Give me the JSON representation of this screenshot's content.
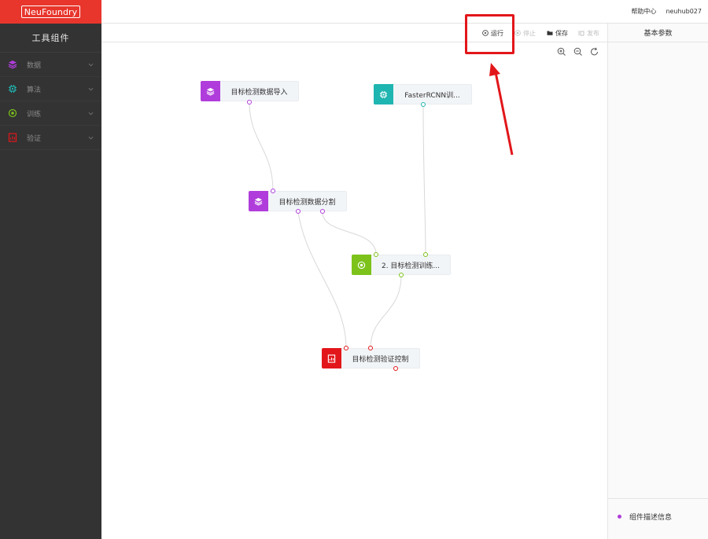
{
  "brand": {
    "logo_text": "NeuFoundry",
    "accent": "#e8362d"
  },
  "header": {
    "help": "帮助中心",
    "user": "neuhub027"
  },
  "sidebar": {
    "title": "工具组件",
    "items": [
      {
        "label": "数据",
        "icon": "layers-icon",
        "color": "#b03ddb"
      },
      {
        "label": "算法",
        "icon": "chip-icon",
        "color": "#1fb5b0"
      },
      {
        "label": "训练",
        "icon": "target-icon",
        "color": "#7cc21a"
      },
      {
        "label": "验证",
        "icon": "report-icon",
        "color": "#e2161a"
      }
    ]
  },
  "toolbar": {
    "run": "运行",
    "stop": "停止",
    "save": "保存",
    "publish": "发布"
  },
  "canvas": {
    "nodes": [
      {
        "id": "n1",
        "label": "目标检测数据导入",
        "icon": "layers-icon",
        "color": "#b03ddb"
      },
      {
        "id": "n2",
        "label": "FasterRCNN训...",
        "icon": "chip-icon",
        "color": "#1fb5b0"
      },
      {
        "id": "n3",
        "label": "目标检测数据分割",
        "icon": "layers-icon",
        "color": "#b03ddb"
      },
      {
        "id": "n4",
        "label": "2. 目标检测训练...",
        "icon": "target-icon",
        "color": "#7cc21a"
      },
      {
        "id": "n5",
        "label": "目标检测验证控制",
        "icon": "report-icon",
        "color": "#e2161a"
      }
    ]
  },
  "right_panel": {
    "title": "基本参数",
    "desc": "组件描述信息",
    "desc_color": "#b03ddb"
  },
  "annotation": {
    "highlight_color": "#e2161a"
  }
}
